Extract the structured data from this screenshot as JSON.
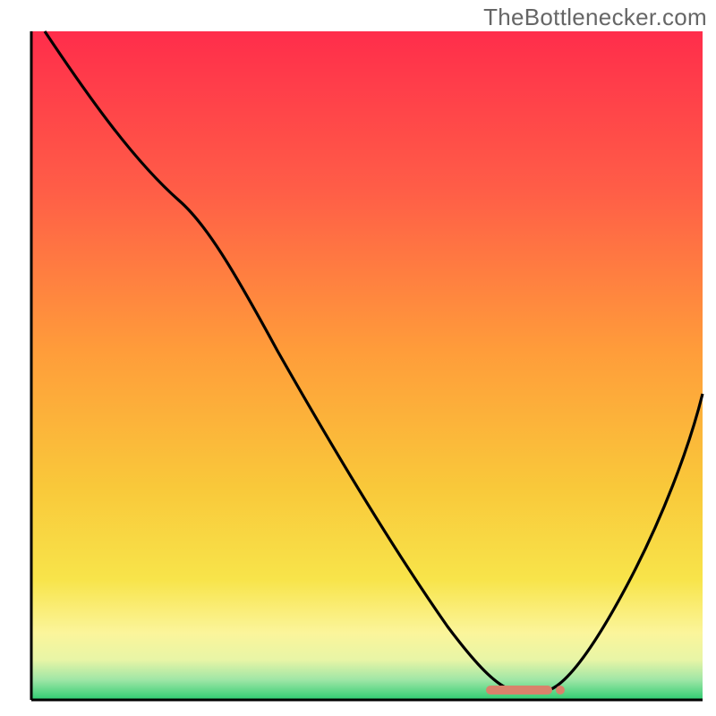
{
  "watermark": "TheBottlenecker.com",
  "chart_data": {
    "type": "line",
    "title": "",
    "xlabel": "",
    "ylabel": "",
    "xlim": [
      0,
      100
    ],
    "ylim": [
      0,
      100
    ],
    "grid": false,
    "legend": false,
    "background_gradient": {
      "top": "#ff2d4b",
      "mid": "#ffd33a",
      "lower": "#fff89a",
      "bottom": "#2ecc71"
    },
    "marker_band": {
      "center_x": 72,
      "y": 2,
      "color": "#d9826b"
    },
    "series": [
      {
        "name": "curve",
        "color": "#000000",
        "x": [
          2,
          10,
          22,
          30,
          40,
          50,
          60,
          66,
          72,
          78,
          84,
          92,
          100
        ],
        "values": [
          100,
          89,
          75,
          66,
          52,
          38,
          23,
          12,
          2,
          2,
          12,
          30,
          50
        ]
      }
    ],
    "colors": {
      "curve": "#000000",
      "marker": "#d9826b",
      "axes": "#000000"
    }
  }
}
